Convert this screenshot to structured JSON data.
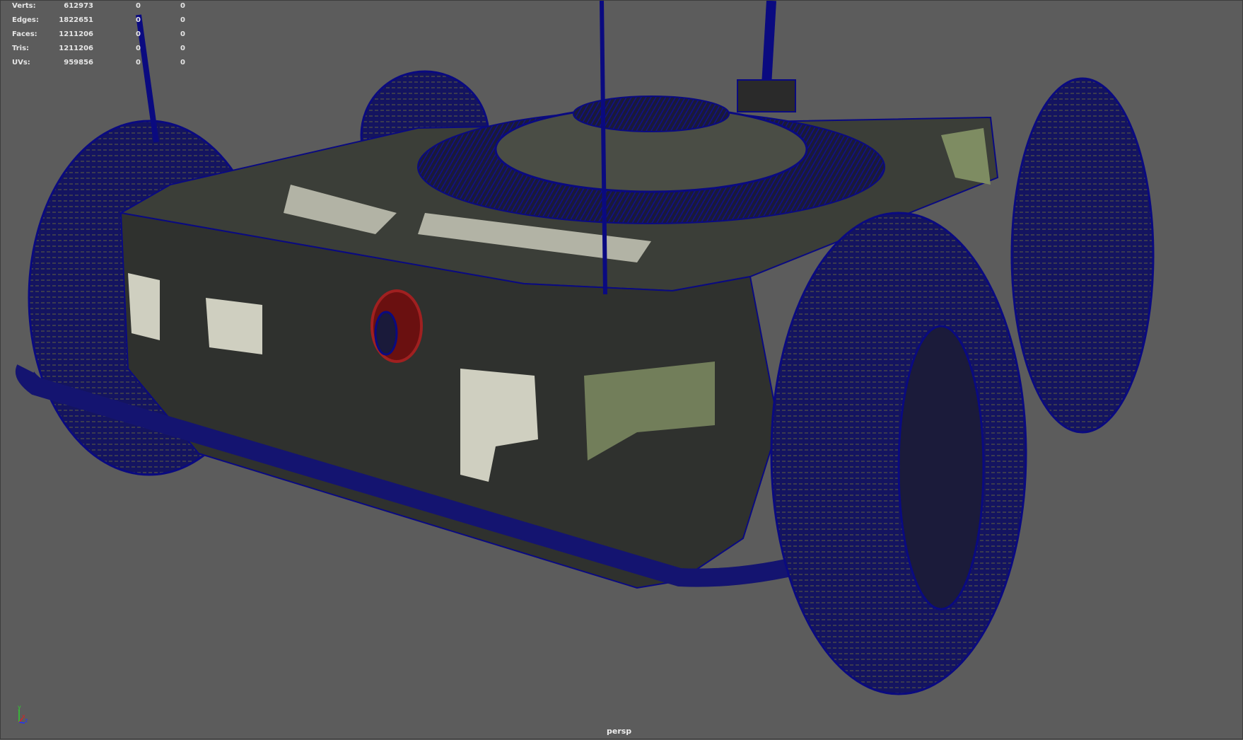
{
  "hud": {
    "rows": [
      {
        "label": "Verts:",
        "total": "612973",
        "selected": "0",
        "extra": "0"
      },
      {
        "label": "Edges:",
        "total": "1822651",
        "selected": "0",
        "extra": "0"
      },
      {
        "label": "Faces:",
        "total": "1211206",
        "selected": "0",
        "extra": "0"
      },
      {
        "label": "Tris:",
        "total": "1211206",
        "selected": "0",
        "extra": "0"
      },
      {
        "label": "UVs:",
        "total": "959856",
        "selected": "0",
        "extra": "0"
      }
    ]
  },
  "viewport": {
    "camera_label": "persp",
    "wireframe_color": "#0a0a80",
    "background": "#5c5c5c"
  },
  "axis": {
    "x": "x",
    "y": "y",
    "z": "z"
  }
}
